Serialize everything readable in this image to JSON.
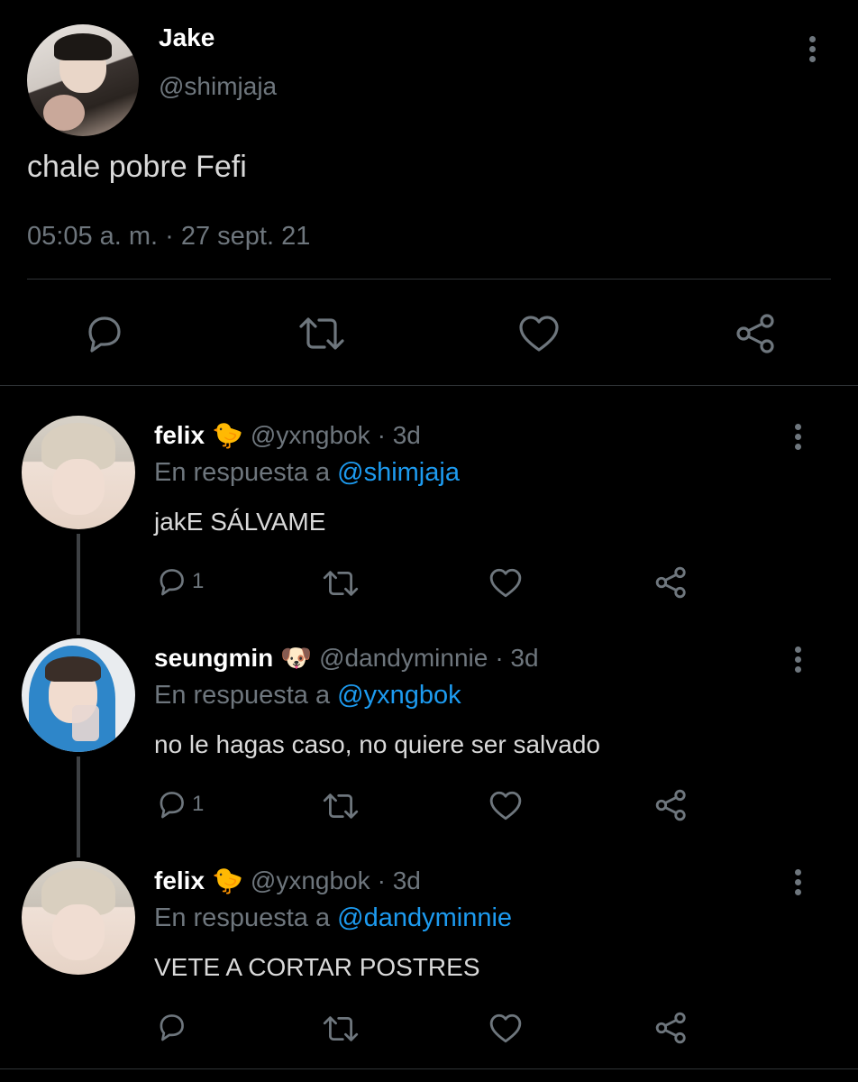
{
  "main_tweet": {
    "display_name": "Jake",
    "handle": "@shimjaja",
    "text": "chale pobre Fefi",
    "timestamp": "05:05 a. m. · 27 sept. 21"
  },
  "replies": [
    {
      "display_name": "felix",
      "emoji": "🐤",
      "handle": "@yxngbok",
      "age": "· 3d",
      "reply_prefix": "En respuesta a",
      "reply_to": "@shimjaja",
      "text": "jakE SÁLVAME",
      "reply_count": "1"
    },
    {
      "display_name": "seungmin",
      "emoji": "🐶",
      "handle": "@dandyminnie",
      "age": "· 3d",
      "reply_prefix": "En respuesta a",
      "reply_to": "@yxngbok",
      "text": "no le hagas caso, no quiere ser salvado",
      "reply_count": "1"
    },
    {
      "display_name": "felix",
      "emoji": "🐤",
      "handle": "@yxngbok",
      "age": "· 3d",
      "reply_prefix": "En respuesta a",
      "reply_to": "@dandyminnie",
      "text": "VETE A CORTAR POSTRES",
      "reply_count": ""
    }
  ],
  "icons": [
    "reply-icon",
    "retweet-icon",
    "like-icon",
    "share-icon",
    "more-icon"
  ],
  "colors": {
    "background": "#000000",
    "link": "#1d9bf0",
    "muted": "#6e767d",
    "text": "#d9d9d9"
  }
}
